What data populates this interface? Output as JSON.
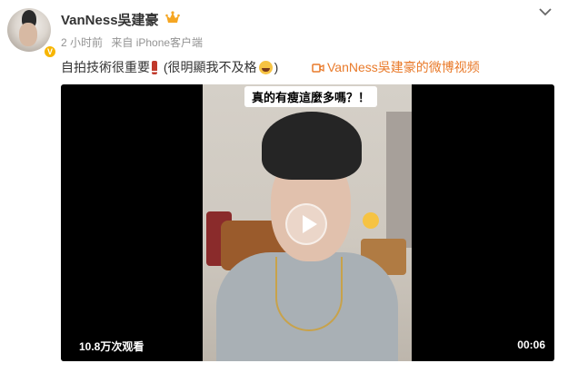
{
  "author": {
    "name": "VanNess吳建豪",
    "verified_badge": "V",
    "badge_icon": "crown-icon"
  },
  "meta": {
    "time": "2 小时前",
    "source": "来自 iPhone客户端"
  },
  "post": {
    "text_part1": "自拍技術很重要",
    "text_part2": "(很明顯我不及格",
    "text_part3": ")",
    "video_link": "VanNess吳建豪的微博视频"
  },
  "video": {
    "caption": "真的有瘦這麼多嗎？！",
    "views": "10.8万次观看",
    "duration": "00:06"
  },
  "colors": {
    "accent_link": "#e97a2a",
    "meta_gray": "#939393",
    "verify_gold": "#f7b500"
  }
}
